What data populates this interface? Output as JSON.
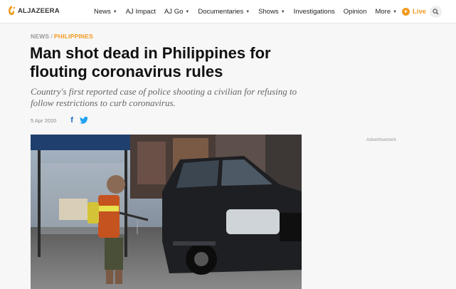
{
  "nav": {
    "logo_text": "ALJAZEERA",
    "items": [
      {
        "label": "News",
        "dropdown": true
      },
      {
        "label": "AJ Impact",
        "dropdown": false
      },
      {
        "label": "AJ Go",
        "dropdown": true
      },
      {
        "label": "Documentaries",
        "dropdown": true
      },
      {
        "label": "Shows",
        "dropdown": true
      },
      {
        "label": "Investigations",
        "dropdown": false
      },
      {
        "label": "Opinion",
        "dropdown": false
      },
      {
        "label": "More",
        "dropdown": true
      }
    ],
    "live_label": "Live"
  },
  "article": {
    "breadcrumb": {
      "section": "NEWS",
      "separator": "/",
      "category": "PHILIPPINES"
    },
    "headline": "Man shot dead in Philippines for flouting coronavirus rules",
    "dek": "Country's first reported case of police shooting a civilian for refusing to follow restrictions to curb coronavirus.",
    "date": "5 Apr 2020",
    "share": {
      "facebook_icon": "facebook-icon",
      "twitter_icon": "twitter-icon"
    }
  },
  "sidebar": {
    "ad_label": "Advertisement"
  },
  "colors": {
    "accent": "#f29a1e",
    "facebook": "#1c69c4",
    "twitter": "#1da1f2",
    "headline": "#111111"
  }
}
